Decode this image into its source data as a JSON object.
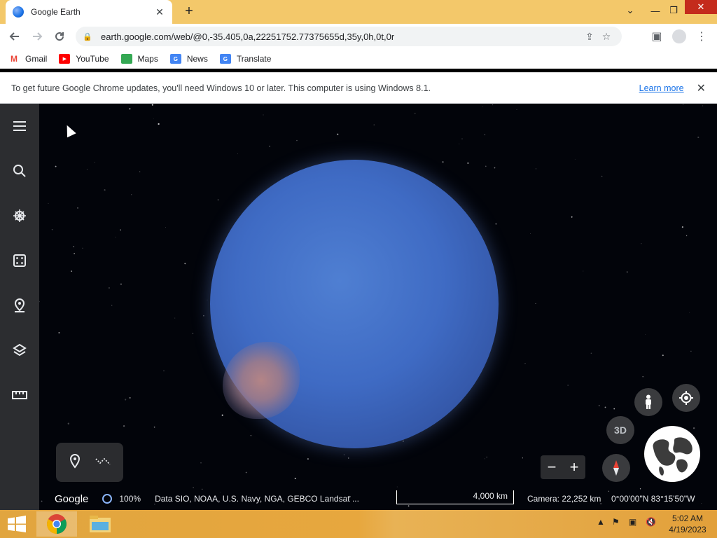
{
  "browser": {
    "tab_title": "Google Earth",
    "new_tab_symbol": "+",
    "url": "earth.google.com/web/@0,-35.405,0a,22251752.77375655d,35y,0h,0t,0r",
    "bookmarks": [
      {
        "label": "Gmail",
        "icon": "gmail-icon",
        "color": "#ea4335"
      },
      {
        "label": "YouTube",
        "icon": "youtube-icon",
        "color": "#ff0000"
      },
      {
        "label": "Maps",
        "icon": "maps-icon",
        "color": "#34a853"
      },
      {
        "label": "News",
        "icon": "news-icon",
        "color": "#4285f4"
      },
      {
        "label": "Translate",
        "icon": "translate-icon",
        "color": "#4285f4"
      }
    ],
    "infobar": {
      "message": "To get future Google Chrome updates, you'll need Windows 10 or later. This computer is using Windows 8.1.",
      "link": "Learn more"
    }
  },
  "earth": {
    "sidebar_icons": [
      "menu-icon",
      "search-icon",
      "voyager-icon",
      "feeling-lucky-icon",
      "projects-icon",
      "map-style-icon",
      "measure-icon"
    ],
    "view_3d_label": "3D",
    "footer": {
      "brand": "Google",
      "load_percent": "100%",
      "attribution": "Data SIO, NOAA, U.S. Navy, NGA, GEBCO  Landsat ...",
      "scale": "4,000 km",
      "camera": "Camera: 22,252 km",
      "coordinates": "0°00'00\"N 83°15'50\"W"
    },
    "zoom_out": "−",
    "zoom_in": "+"
  },
  "taskbar": {
    "time": "5:02 AM",
    "date": "4/19/2023"
  },
  "colors": {
    "tabstrip": "#f3c86a",
    "sidebar": "#2c2d30",
    "accent": "#1a73e8"
  }
}
